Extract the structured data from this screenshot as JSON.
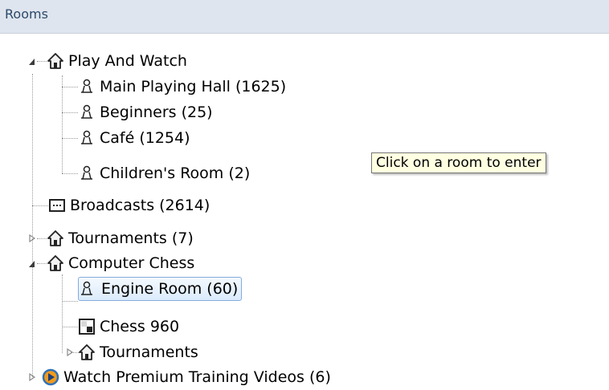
{
  "panel": {
    "title": "Rooms"
  },
  "tree": {
    "play_and_watch": {
      "label": "Play And Watch",
      "children": [
        {
          "label": "Main Playing Hall  (1625)"
        },
        {
          "label": "Beginners  (25)"
        },
        {
          "label": "Café  (1254)"
        },
        {
          "label": "Children's Room  (2)"
        }
      ]
    },
    "broadcasts": {
      "label": "Broadcasts  (2614)"
    },
    "tournaments": {
      "label": "Tournaments  (7)"
    },
    "computer_chess": {
      "label": "Computer Chess",
      "children": [
        {
          "label": "Engine Room  (60)",
          "selected": true
        },
        {
          "label": "Chess 960"
        },
        {
          "label": "Tournaments"
        }
      ]
    },
    "premium_videos": {
      "label": "Watch Premium Training Videos  (6)"
    }
  },
  "tooltip": {
    "text": "Click on a room to enter"
  },
  "icons": {
    "home": "home-icon",
    "room": "pawn-icon",
    "broadcast": "broadcast-icon",
    "chess960": "board-icon",
    "video": "play-video-icon"
  }
}
